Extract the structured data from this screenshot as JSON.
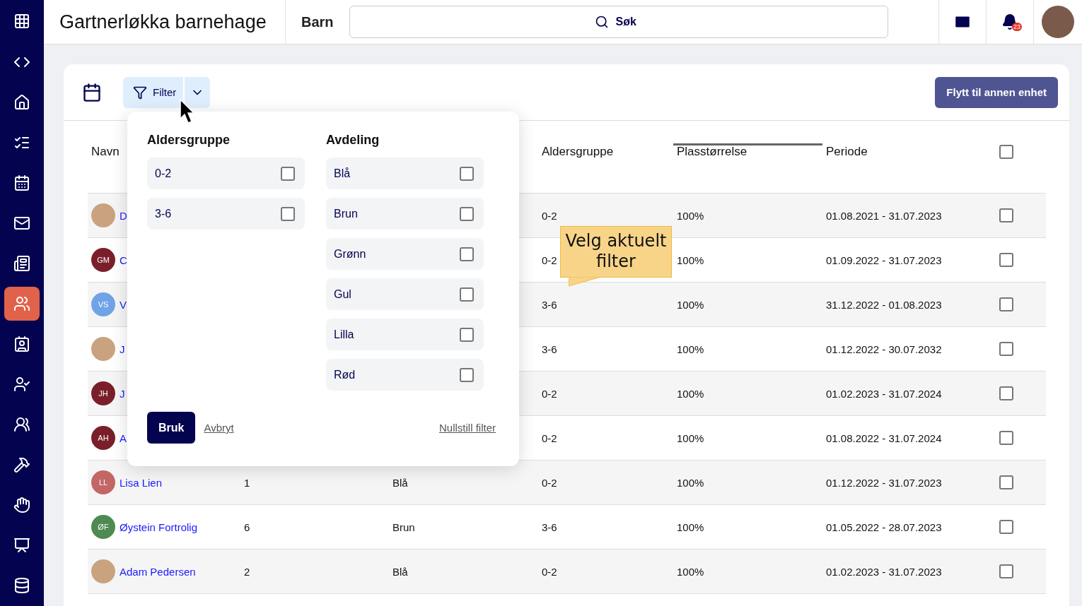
{
  "topbar": {
    "title": "Gartnerløkka barnehage",
    "section": "Barn",
    "search": {
      "placeholder": "Søk"
    },
    "notifications": "23"
  },
  "sidebar": {
    "items": [
      {
        "selected": false
      },
      {
        "selected": false
      },
      {
        "selected": false
      },
      {
        "selected": false
      },
      {
        "selected": false
      },
      {
        "selected": false
      },
      {
        "selected": true
      },
      {
        "selected": false
      },
      {
        "selected": false
      },
      {
        "selected": false
      },
      {
        "selected": false
      },
      {
        "selected": false
      },
      {
        "selected": false
      },
      {
        "selected": false
      }
    ]
  },
  "toolbar": {
    "filter": {
      "label": "Filter",
      "expanded": true
    },
    "move_button": "Flytt til annen enhet"
  },
  "table": {
    "columns": [
      {
        "label": "Navn",
        "sorted": false
      },
      {
        "label": "Aldersgruppe",
        "sorted": false
      },
      {
        "label": "Plasstørrelse",
        "sorted": true
      },
      {
        "label": "Periode",
        "sorted": false
      }
    ],
    "select_all": {
      "checked": false
    },
    "rows": [
      {
        "avatar": {
          "kind": "photo"
        },
        "name": "D",
        "age_group": "0-2",
        "size": "100%",
        "period": "01.08.2021 - 31.07.2023",
        "checked": false
      },
      {
        "avatar": {
          "kind": "initials",
          "initials": "GM",
          "color": "#7a1f2a"
        },
        "name": "C",
        "age_group": "0-2",
        "size": "100%",
        "period": "01.09.2022 - 31.07.2023",
        "checked": false
      },
      {
        "avatar": {
          "kind": "initials",
          "initials": "VS",
          "color": "#6fa3e6"
        },
        "name": "V",
        "age_group": "3-6",
        "size": "100%",
        "period": "31.12.2022 - 01.08.2023",
        "checked": false
      },
      {
        "avatar": {
          "kind": "photo"
        },
        "name": "J",
        "age_group": "3-6",
        "size": "100%",
        "period": "01.12.2022 - 30.07.2032",
        "checked": false
      },
      {
        "avatar": {
          "kind": "initials",
          "initials": "JH",
          "color": "#7a1f2a"
        },
        "name": "J",
        "age_group": "0-2",
        "size": "100%",
        "period": "01.02.2023 - 31.07.2024",
        "checked": false
      },
      {
        "avatar": {
          "kind": "initials",
          "initials": "AH",
          "color": "#7a1f2a"
        },
        "name": "A",
        "age_group": "0-2",
        "size": "100%",
        "period": "01.08.2022 - 31.07.2024",
        "checked": false
      },
      {
        "avatar": {
          "kind": "initials",
          "initials": "LL",
          "color": "#c46666"
        },
        "name": "Lisa Lien",
        "column_2": "1",
        "column_3": "Blå",
        "age_group": "0-2",
        "size": "100%",
        "period": "01.12.2022 - 31.07.2023",
        "checked": false
      },
      {
        "avatar": {
          "kind": "initials",
          "initials": "ØF",
          "color": "#4e8a52"
        },
        "name": "Øystein Fortrolig",
        "column_2": "6",
        "column_3": "Brun",
        "age_group": "3-6",
        "size": "100%",
        "period": "01.05.2022 - 28.07.2023",
        "checked": false
      },
      {
        "avatar": {
          "kind": "photo"
        },
        "name": "Adam Pedersen",
        "column_2": "2",
        "column_3": "Blå",
        "age_group": "0-2",
        "size": "100%",
        "period": "01.02.2023 - 31.07.2023",
        "checked": false
      }
    ]
  },
  "filter_popup": {
    "groups": [
      {
        "title": "Aldersgruppe",
        "options": [
          {
            "label": "0-2",
            "checked": false
          },
          {
            "label": "3-6",
            "checked": false
          }
        ]
      },
      {
        "title": "Avdeling",
        "options": [
          {
            "label": "Blå",
            "checked": false
          },
          {
            "label": "Brun",
            "checked": false
          },
          {
            "label": "Grønn",
            "checked": false
          },
          {
            "label": "Gul",
            "checked": false
          },
          {
            "label": "Lilla",
            "checked": false
          },
          {
            "label": "Rød",
            "checked": false
          }
        ]
      }
    ],
    "apply": "Bruk",
    "cancel": "Avbryt",
    "reset": "Nullstill filter"
  },
  "callout": "Velg aktuelt filter"
}
